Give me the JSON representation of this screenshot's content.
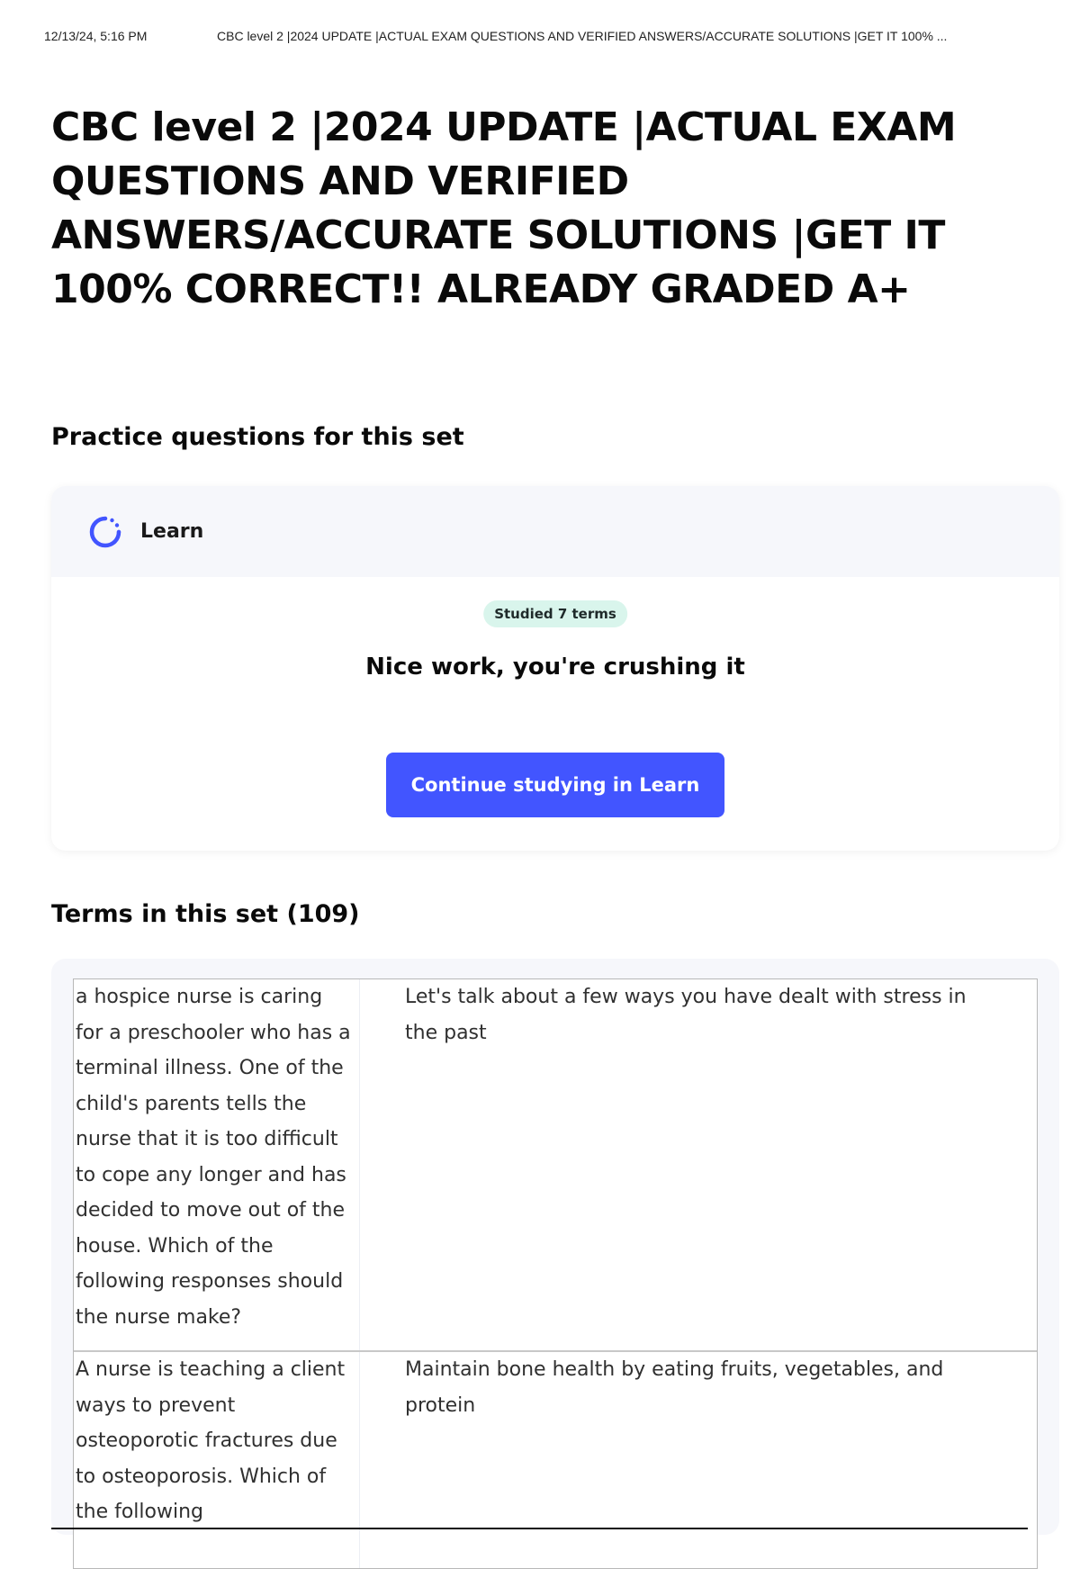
{
  "print_header": {
    "datetime": "12/13/24, 5:16 PM",
    "title": "CBC level 2 |2024 UPDATE |ACTUAL EXAM QUESTIONS AND VERIFIED ANSWERS/ACCURATE SOLUTIONS |GET IT 100% ..."
  },
  "page": {
    "title": "CBC level 2 |2024 UPDATE |ACTUAL EXAM QUESTIONS AND VERIFIED ANSWERS/ACCURATE SOLUTIONS |GET IT 100% CORRECT!! ALREADY GRADED A+"
  },
  "practice": {
    "heading": "Practice questions for this set",
    "learn_label": "Learn",
    "badge": "Studied 7 terms",
    "message": "Nice work, you're crushing it",
    "button_label": "Continue studying in Learn",
    "icon": "learn-progress-icon",
    "accent_color": "#4255ff",
    "badge_color": "#d9f5ec"
  },
  "terms": {
    "heading": "Terms in this set (109)",
    "rows": [
      {
        "term": "a hospice nurse is caring for a preschooler who has a terminal illness. One of the child's parents tells the nurse that it is too difficult to cope any longer and has decided to move out of the house. Which of the following responses should the nurse make?",
        "definition": "Let's talk about a few ways you have dealt with stress in the past"
      },
      {
        "term": "A nurse is teaching a client ways to prevent osteoporotic fractures due to osteoporosis. Which of the following",
        "definition": "Maintain bone health by eating fruits, vegetables, and protein"
      }
    ]
  }
}
